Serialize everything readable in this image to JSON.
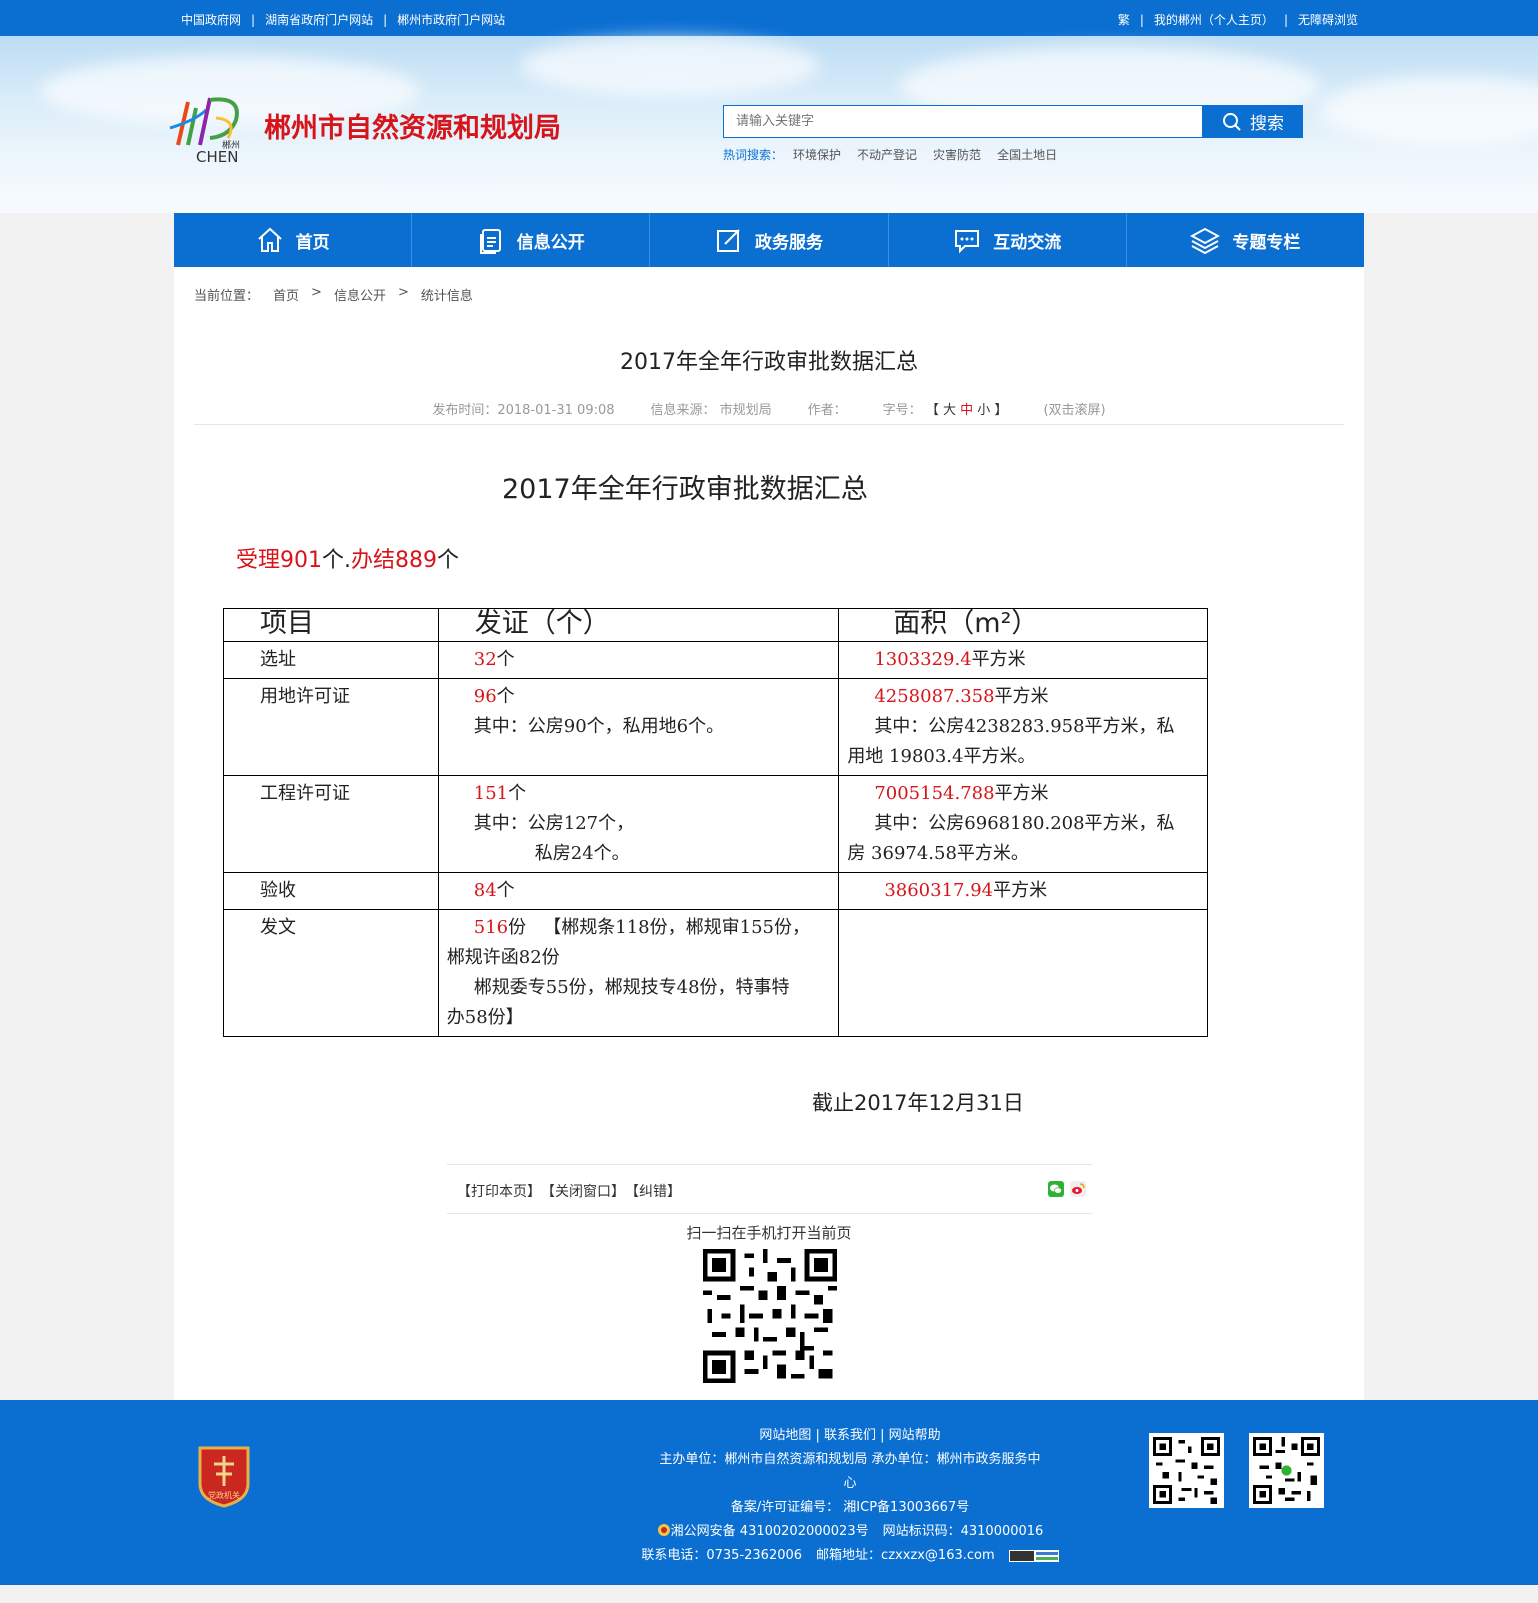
{
  "topbar": {
    "left_links": [
      "中国政府网",
      "湖南省政府门户网站",
      "郴州市政府门户网站"
    ],
    "right_links": [
      "繁",
      "我的郴州（个人主页）",
      "无障碍浏览"
    ]
  },
  "header": {
    "site_title": "郴州市自然资源和规划局",
    "logo_text": "CHEN",
    "logo_small": "郴州",
    "search_placeholder": "请输入关键字",
    "search_button": "搜索",
    "hot_label": "热词搜索：",
    "hot_words": [
      "环境保护",
      "不动产登记",
      "灾害防范",
      "全国土地日"
    ]
  },
  "nav": {
    "items": [
      "首页",
      "信息公开",
      "政务服务",
      "互动交流",
      "专题专栏"
    ]
  },
  "breadcrumb": {
    "label": "当前位置：",
    "items": [
      "首页",
      "信息公开",
      "统计信息"
    ],
    "sep": ">"
  },
  "article": {
    "title": "2017年全年行政审批数据汇总",
    "meta_time": "发布时间：2018-01-31 09:08",
    "meta_source": "信息来源： 市规划局",
    "meta_author": "作者：",
    "meta_size_label": "字号：",
    "size_open": "【",
    "size_large": "大",
    "size_mid": "中",
    "size_small": "小",
    "size_close": "】",
    "meta_scroll": "(双击滚屏)",
    "content_title": "2017年全年行政审批数据汇总",
    "summary": {
      "p1": "受理901",
      "p2": "个.",
      "p3": "办结889",
      "p4": "个"
    },
    "table": {
      "headers": [
        "项目",
        "发证（个）",
        "面积（m²）"
      ],
      "row1": {
        "item": "选址",
        "count_red": "32",
        "count_unit": "个",
        "area_red": "1303329.4",
        "area_unit": "平方米"
      },
      "row2": {
        "item": "用地许可证",
        "count_red": "96",
        "count_unit": "个",
        "count_detail": "其中：公房90个，私用地6个。",
        "area_red": "4258087.358",
        "area_unit": "平方米",
        "area_detail1": "其中：公房4238283.958平方米，私",
        "area_detail2": "用地 19803.4平方米。"
      },
      "row3": {
        "item": "工程许可证",
        "count_red": "151",
        "count_unit": "个",
        "count_detail1": "其中：公房127个，",
        "count_detail2": "私房24个。",
        "area_red": "7005154.788",
        "area_unit": "平方米",
        "area_detail1": "其中：公房6968180.208平方米，私",
        "area_detail2": "房 36974.58平方米。"
      },
      "row4": {
        "item": "验收",
        "count_red": "84",
        "count_unit": "个",
        "area_red": "3860317.94",
        "area_unit": "平方米"
      },
      "row5": {
        "item": "发文",
        "count_red": "516",
        "count_unit": "份",
        "detail1": "【郴规条118份，郴规审155份，",
        "detail2": "郴规许函82份",
        "detail3": "郴规委专55份，郴规技专48份，特事特",
        "detail4": "办58份】"
      }
    },
    "deadline": "截止2017年12月31日"
  },
  "actions": {
    "print": "【打印本页】",
    "close": "【关闭窗口】",
    "correct": "【纠错】",
    "scan_text": "扫一扫在手机打开当前页"
  },
  "footer": {
    "links": "网站地图 | 联系我们 | 网站帮助",
    "host": "主办单位：郴州市自然资源和规划局   承办单位：郴州市政务服务中",
    "host_cont": "心",
    "icp": "备案/许可证编号： 湘ICP备13003667号",
    "police": "湘公网安备 43100202000023号",
    "site_id": "网站标识码：4310000016",
    "phone": "联系电话：0735-2362006",
    "email": "邮箱地址：czxxzx@163.com",
    "emblem_text": "党政机关"
  },
  "colors": {
    "brand_blue": "#0b6fd2",
    "title_red": "#d8141b"
  }
}
